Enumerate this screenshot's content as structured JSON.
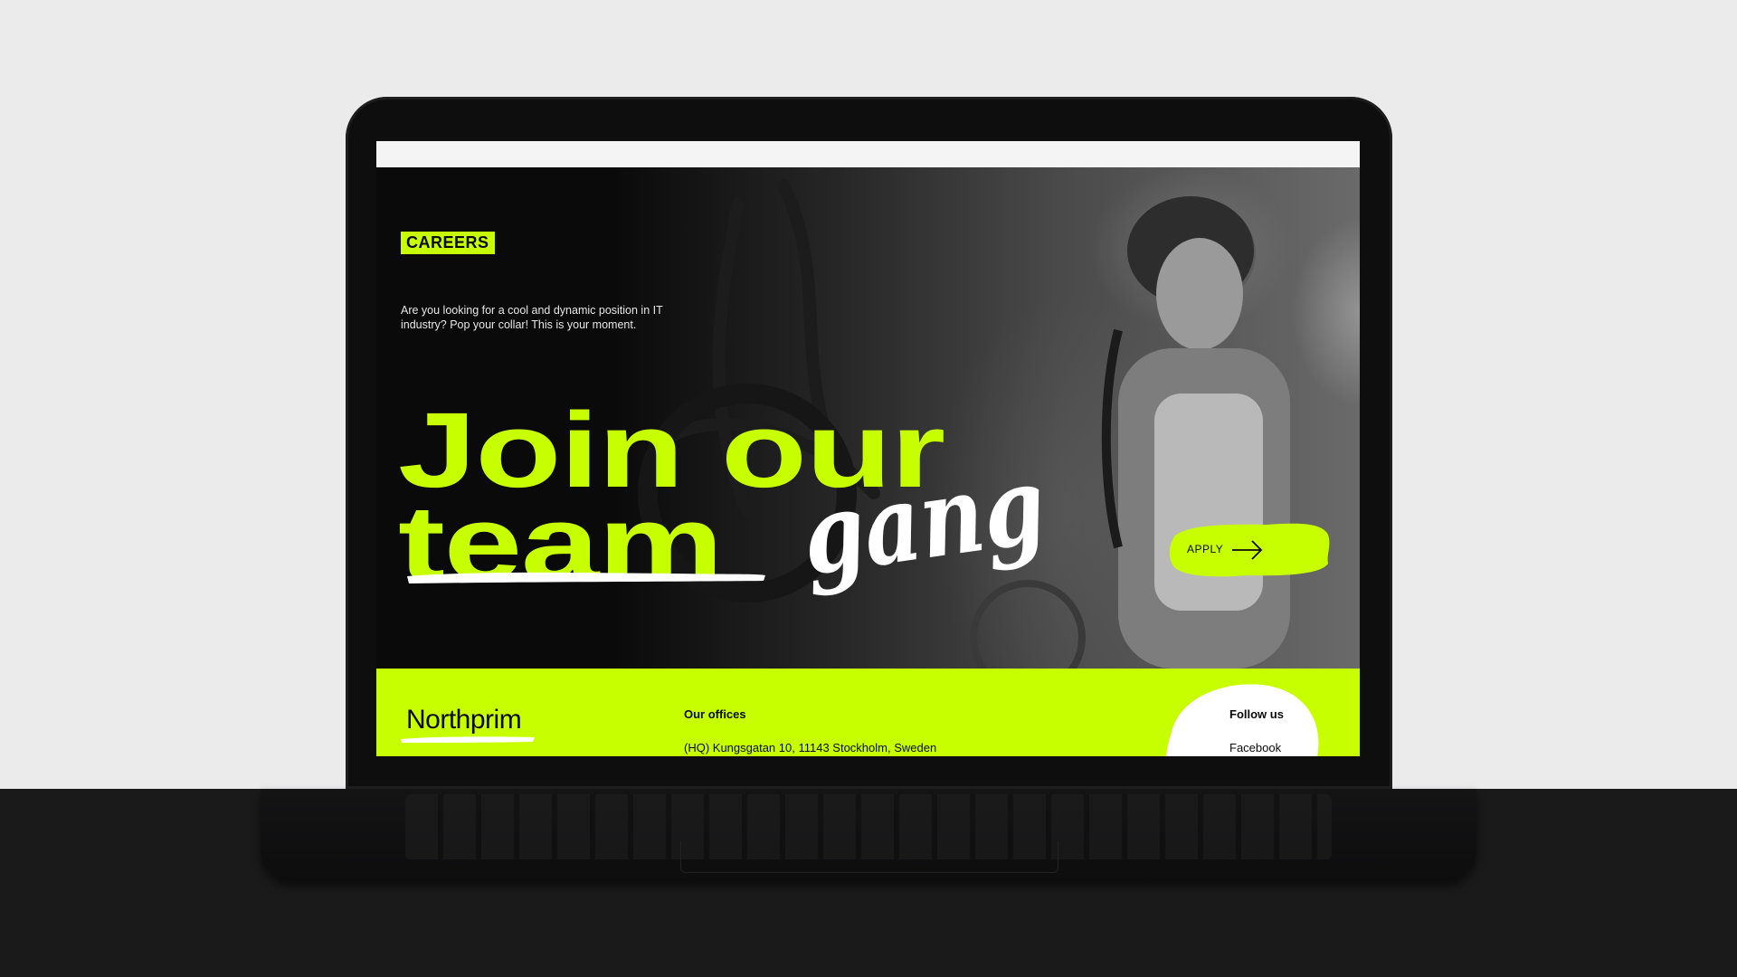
{
  "colors": {
    "accent": "#c8ff00",
    "background": "#0a0a0a",
    "text_light": "#ffffff"
  },
  "hero": {
    "tag": "CAREERS",
    "intro": "Are you looking for a cool and dynamic position in IT industry? Pop your collar! This is your moment.",
    "headline_line1": "Join our",
    "headline_struck": "team",
    "headline_script": "gang",
    "apply_label": "APPLY",
    "apply_icon": "arrow-right-icon"
  },
  "footer": {
    "logo": "Northprim",
    "offices_title": "Our offices",
    "offices_address": "(HQ) Kungsgatan 10, 11143 Stockholm, Sweden",
    "follow_title": "Follow us",
    "follow_links": [
      "Facebook"
    ]
  }
}
